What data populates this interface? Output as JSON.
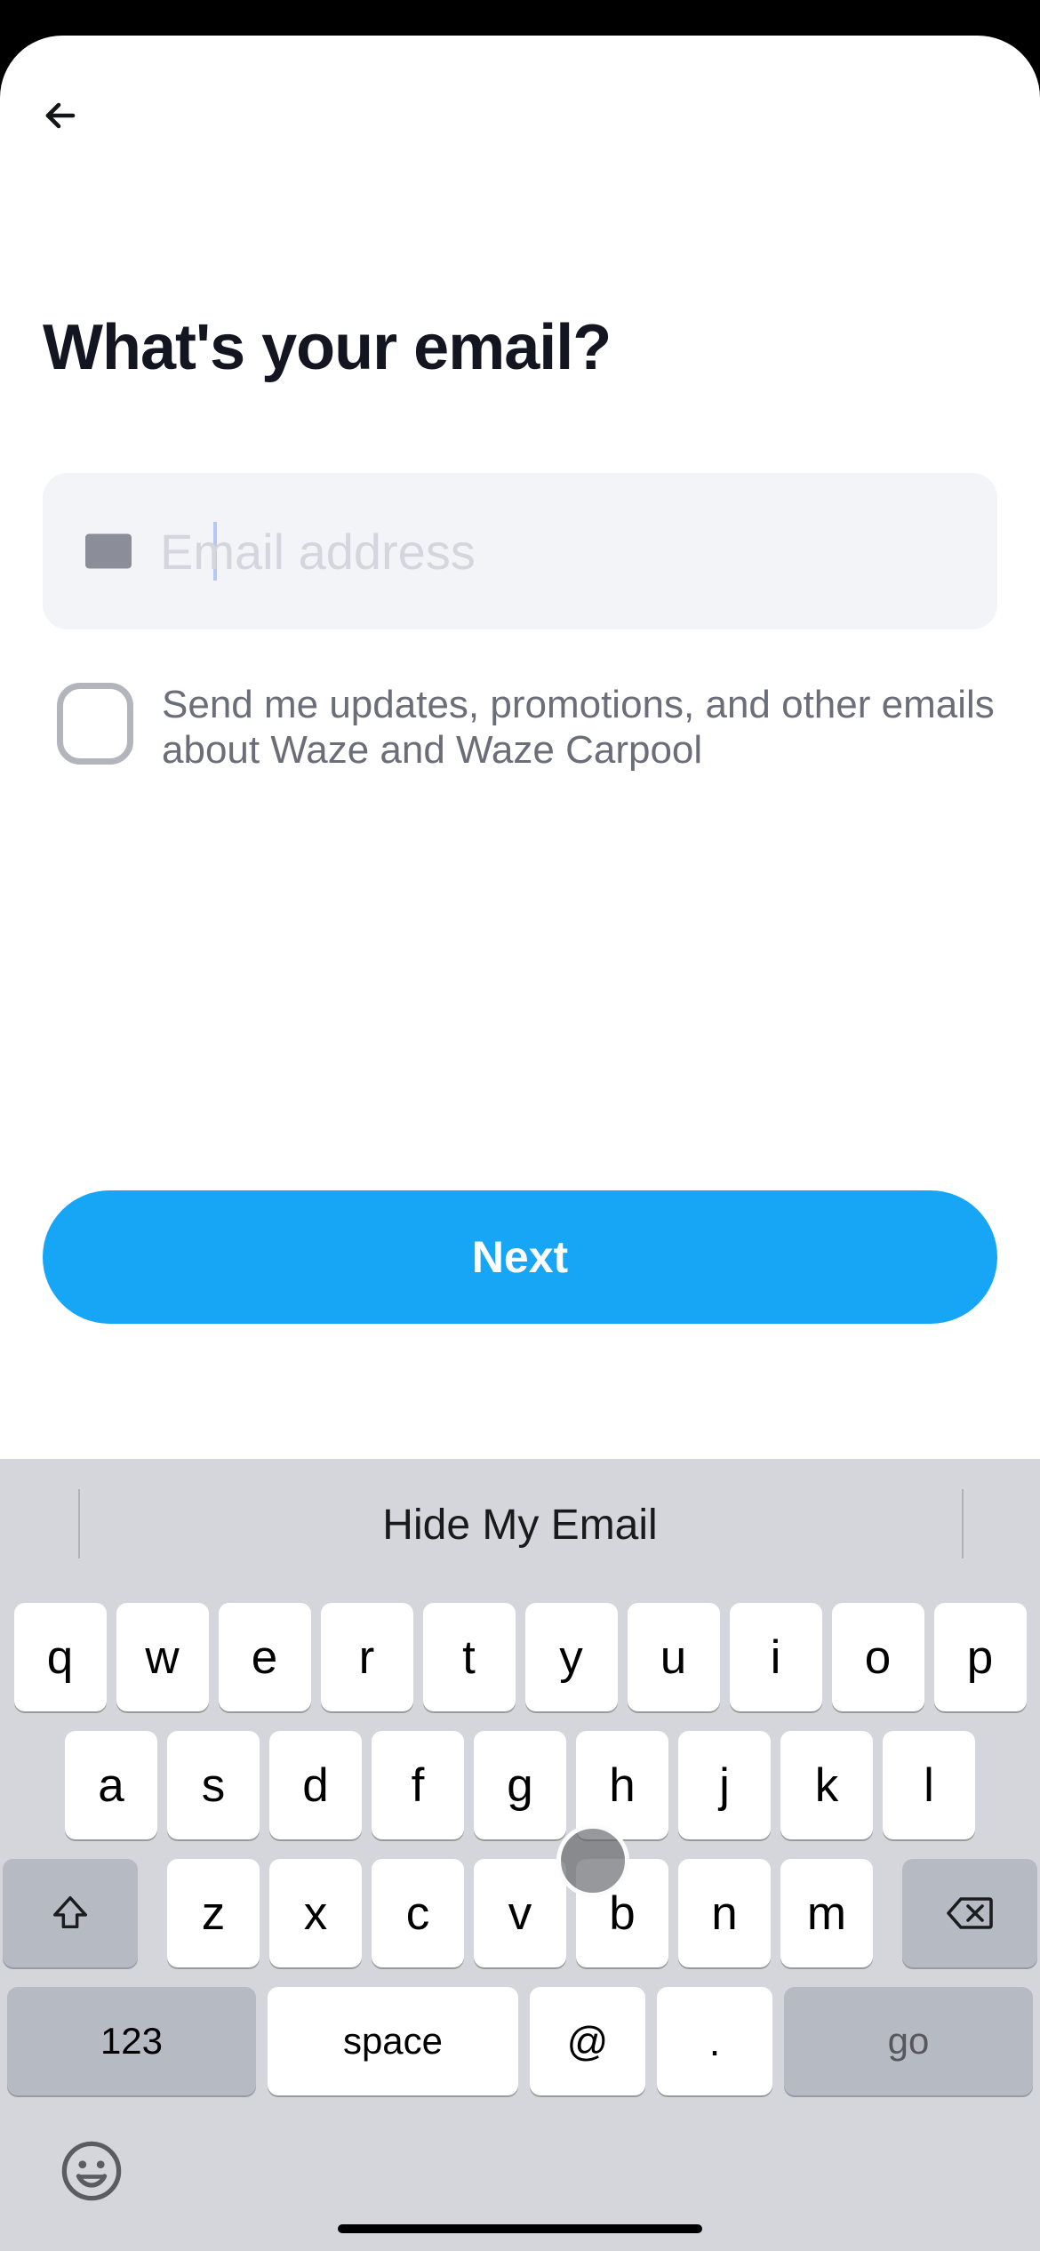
{
  "header": {
    "title": "What's your email?"
  },
  "email_input": {
    "value": "",
    "placeholder": "Email address"
  },
  "checkbox": {
    "checked": false,
    "label": "Send me updates, promotions, and other emails about Waze and Waze Carpool"
  },
  "primary_button": {
    "label": "Next"
  },
  "keyboard": {
    "suggestion": "Hide My Email",
    "row1": [
      "q",
      "w",
      "e",
      "r",
      "t",
      "y",
      "u",
      "i",
      "o",
      "p"
    ],
    "row2": [
      "a",
      "s",
      "d",
      "f",
      "g",
      "h",
      "j",
      "k",
      "l"
    ],
    "row3": [
      "z",
      "x",
      "c",
      "v",
      "b",
      "n",
      "m"
    ],
    "num_key": "123",
    "space_key": "space",
    "at_key": "@",
    "dot_key": ".",
    "go_key": "go"
  }
}
